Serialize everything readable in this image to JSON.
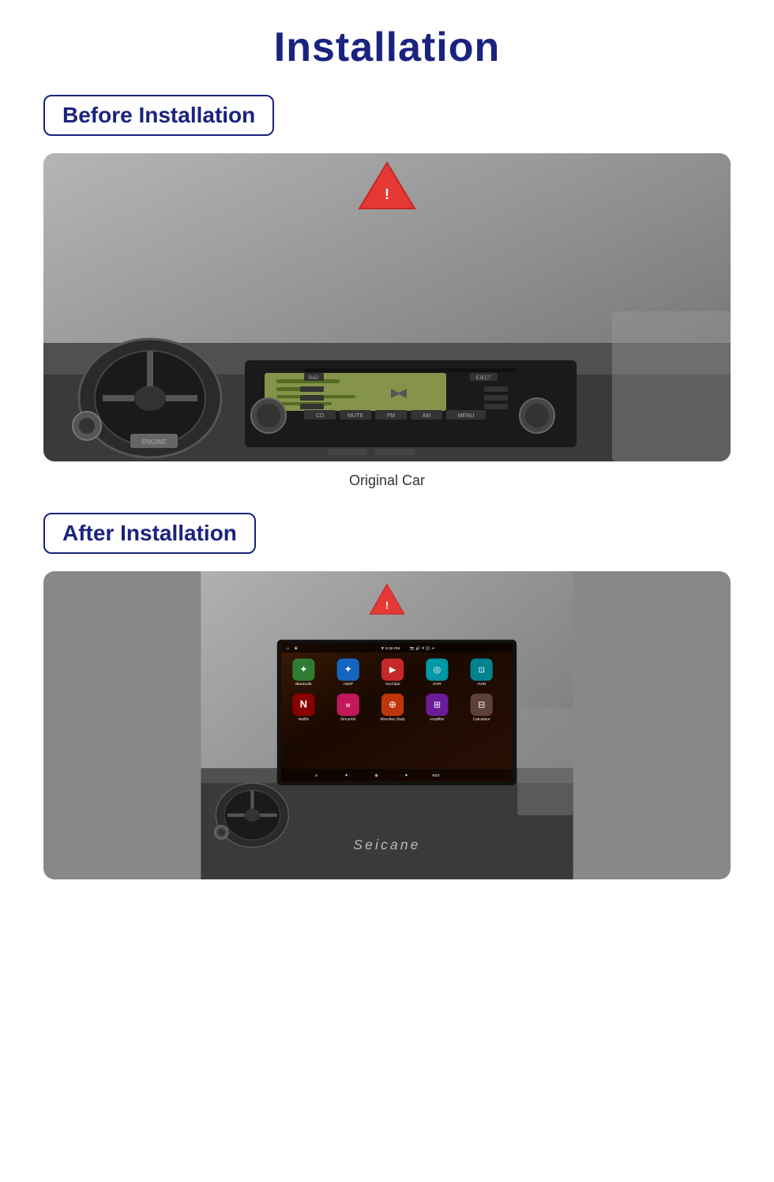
{
  "page": {
    "title": "Installation"
  },
  "before_section": {
    "label": "Before Installation",
    "caption": "Original Car"
  },
  "after_section": {
    "label": "After Installation"
  },
  "status_bar": {
    "time": "5:28 PM",
    "left_icons": [
      "⌂",
      "⊕"
    ]
  },
  "apps_row1": [
    {
      "name": "bluetooth-app-icon",
      "label": "Bluetooth",
      "bg": "bg-green",
      "icon": "✦"
    },
    {
      "name": "a2dp-app-icon",
      "label": "A2DP",
      "bg": "bg-blue-dark",
      "icon": "✦"
    },
    {
      "name": "youtube-app-icon",
      "label": "YouTube",
      "bg": "bg-red",
      "icon": "▶"
    },
    {
      "name": "dvr-app-icon",
      "label": "DVR",
      "bg": "bg-cyan",
      "icon": "◎"
    },
    {
      "name": "avin-app-icon",
      "label": "AVIN",
      "bg": "bg-teal",
      "icon": "⊡"
    }
  ],
  "apps_row2": [
    {
      "name": "netflix-app-icon",
      "label": "Netflix",
      "bg": "bg-red-netflix",
      "icon": "N"
    },
    {
      "name": "siriusxm-app-icon",
      "label": "SiriusXM",
      "bg": "bg-pink",
      "icon": "≋"
    },
    {
      "name": "wheelkey-app-icon",
      "label": "Wheelkey Study",
      "bg": "bg-orange-dark",
      "icon": "⊕"
    },
    {
      "name": "amplifier-app-icon",
      "label": "Amplifier",
      "bg": "bg-purple",
      "icon": "⊞"
    },
    {
      "name": "calculator-app-icon",
      "label": "Calculator",
      "bg": "bg-brown",
      "icon": "⊟"
    }
  ],
  "bottom_icons": [
    "≡",
    "✦",
    "⊕",
    "✦",
    "RST"
  ],
  "seicane_logo": "Seicane"
}
